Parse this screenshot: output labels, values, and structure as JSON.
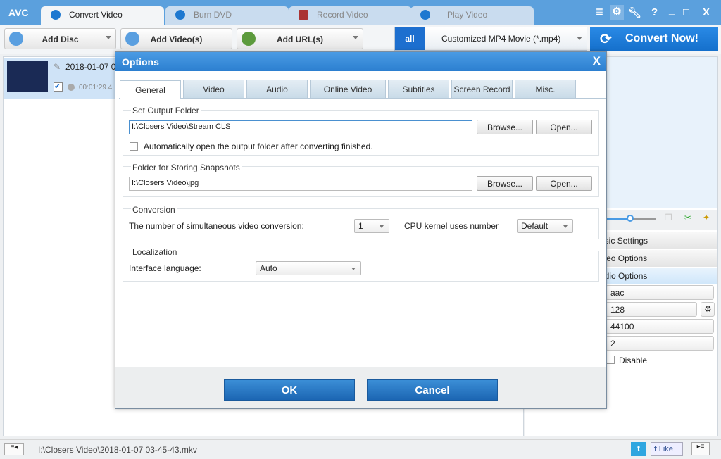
{
  "app": {
    "logo": "AVC"
  },
  "tabs": [
    {
      "label": "Convert Video"
    },
    {
      "label": "Burn DVD"
    },
    {
      "label": "Record Video"
    },
    {
      "label": "Play Video"
    }
  ],
  "window_controls": {
    "help": "?",
    "minimize": "_",
    "maximize": "□",
    "close": "X"
  },
  "toolbar": {
    "add_disc": "Add Disc",
    "add_videos": "Add Video(s)",
    "add_url": "Add URL(s)",
    "profile_icon": "all",
    "profile": "Customized MP4 Movie (*.mp4)",
    "convert": "Convert Now!"
  },
  "file": {
    "name": "2018-01-07 0",
    "duration": "00:01:29.4"
  },
  "right_panel": {
    "sections": [
      "Basic Settings",
      "Video Options",
      "Audio Options"
    ],
    "codec": "aac",
    "bitrate": "128",
    "sample_rate": "44100",
    "channels": "2",
    "disable": "Disable",
    "slider_level": 0.4
  },
  "status": {
    "path": "I:\\Closers Video\\2018-01-07 03-45-43.mkv",
    "like": "Like"
  },
  "dialog": {
    "title": "Options",
    "close": "X",
    "tabs": [
      "General",
      "Video",
      "Audio",
      "Online Video",
      "Subtitles",
      "Screen Record",
      "Misc."
    ],
    "output": {
      "label": "Set Output Folder",
      "path": "I:\\Closers Video\\Stream CLS",
      "browse": "Browse...",
      "open": "Open...",
      "auto_open": "Automatically open the output folder after converting finished."
    },
    "snapshots": {
      "label": "Folder for Storing Snapshots",
      "path": "I:\\Closers Video\\jpg",
      "browse": "Browse...",
      "open": "Open..."
    },
    "conversion": {
      "label": "Conversion",
      "simultaneous_label": "The number of simultaneous video conversion:",
      "simultaneous": "1",
      "cpu_label": "CPU kernel uses number",
      "cpu": "Default"
    },
    "localization": {
      "label": "Localization",
      "lang_label": "Interface language:",
      "lang": "Auto"
    },
    "ok": "OK",
    "cancel": "Cancel"
  }
}
